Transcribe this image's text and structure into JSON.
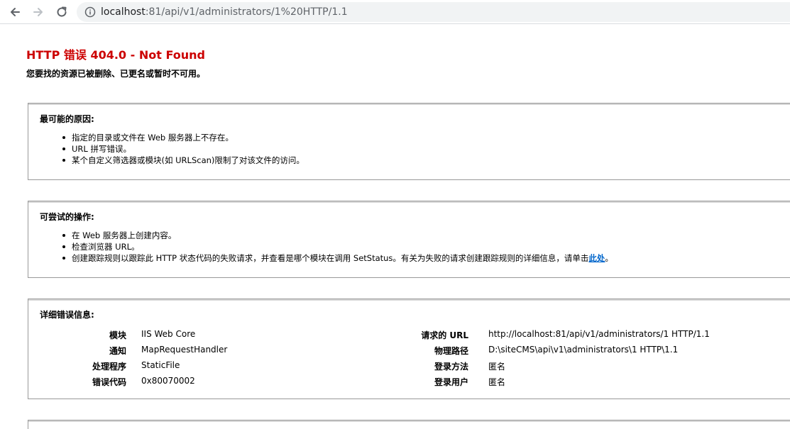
{
  "browser": {
    "url_host": "localhost",
    "url_path": ":81/api/v1/administrators/1%20HTTP/1.1"
  },
  "error": {
    "title": "HTTP 错误 404.0 - Not Found",
    "subtitle": "您要找的资源已被删除、已更名或暂时不可用。"
  },
  "causes": {
    "heading": "最可能的原因:",
    "items": [
      "指定的目录或文件在 Web 服务器上不存在。",
      "URL 拼写错误。",
      "某个自定义筛选器或模块(如 URLScan)限制了对该文件的访问。"
    ]
  },
  "actions": {
    "heading": "可尝试的操作:",
    "items": [
      "在 Web 服务器上创建内容。",
      "检查浏览器 URL。"
    ],
    "item3_text": "创建跟踪规则以跟踪此 HTTP 状态代码的失败请求，并查看是哪个模块在调用 SetStatus。有关为失败的请求创建跟踪规则的详细信息，请单击",
    "item3_link": "此处",
    "item3_end": "。"
  },
  "details": {
    "heading": "详细错误信息:",
    "left": [
      {
        "label": "模块",
        "value": "IIS Web Core"
      },
      {
        "label": "通知",
        "value": "MapRequestHandler"
      },
      {
        "label": "处理程序",
        "value": "StaticFile"
      },
      {
        "label": "错误代码",
        "value": "0x80070002"
      }
    ],
    "right": [
      {
        "label": "请求的 URL",
        "value": "http://localhost:81/api/v1/administrators/1 HTTP/1.1"
      },
      {
        "label": "物理路径",
        "value": "D:\\siteCMS\\api\\v1\\administrators\\1 HTTP\\1.1"
      },
      {
        "label": "登录方法",
        "value": "匿名"
      },
      {
        "label": "登录用户",
        "value": "匿名"
      }
    ]
  },
  "colors": {
    "title": "#cc0000",
    "link": "#0066cc",
    "border": "#999999"
  }
}
